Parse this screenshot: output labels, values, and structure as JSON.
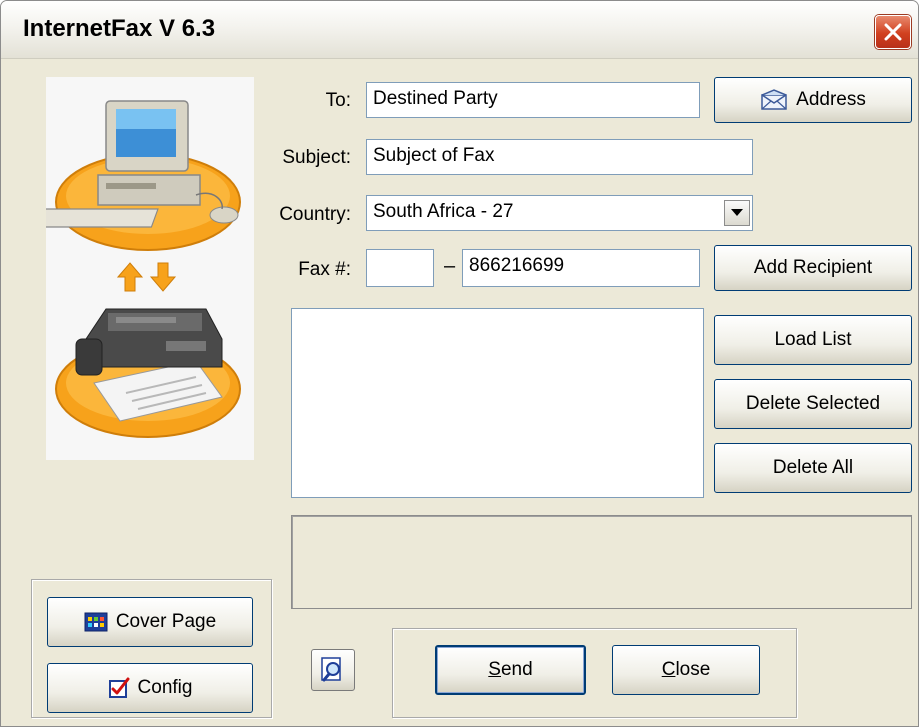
{
  "window": {
    "title": "InternetFax V 6.3"
  },
  "form": {
    "to_label": "To:",
    "to_value": "Destined Party",
    "subject_label": "Subject:",
    "subject_value": "Subject of Fax",
    "country_label": "Country:",
    "country_value": "South Africa - 27",
    "fax_label": "Fax #:",
    "fax_area_value": "",
    "fax_dash": "–",
    "fax_number_value": "866216699"
  },
  "buttons": {
    "address": "Address",
    "add_recipient": "Add Recipient",
    "load_list": "Load List",
    "delete_selected": "Delete Selected",
    "delete_all": "Delete All",
    "cover_page": "Cover Page",
    "config": "Config",
    "send_first": "S",
    "send_rest": "end",
    "close_first": "C",
    "close_rest": "lose"
  },
  "recipients": [],
  "status_text": "",
  "colors": {
    "window_bg": "#ece9d8",
    "close_red": "#d1401f",
    "orange": "#f7a21b",
    "button_border": "#003c74"
  },
  "icons": [
    "close-icon",
    "computer-icon",
    "fax-machine-icon",
    "upload-arrow-icon",
    "download-arrow-icon",
    "envelope-icon",
    "dropdown-arrow-icon",
    "cover-page-icon",
    "config-icon",
    "preview-icon"
  ]
}
